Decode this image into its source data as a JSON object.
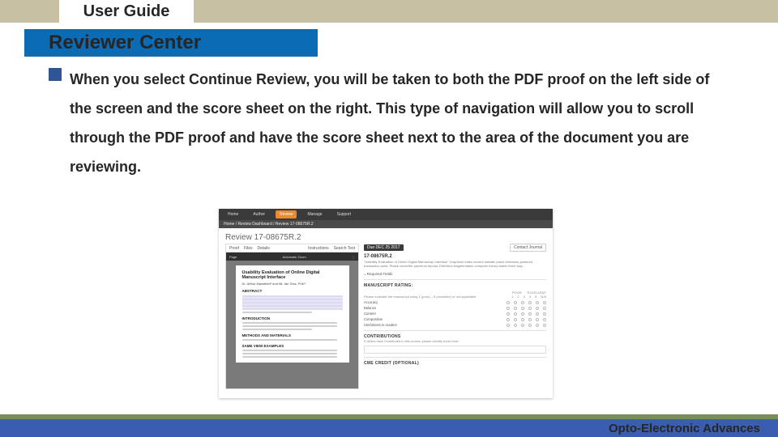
{
  "header": {
    "title": "User Guide"
  },
  "section": {
    "title": "Reviewer Center"
  },
  "body": {
    "paragraph": "When you select Continue Review, you will be taken to both the PDF proof on the left side of the screen and the score sheet on the right. This type of navigation will allow you to scroll through the PDF proof and have the score sheet next to the area of the document you are reviewing."
  },
  "footer": {
    "journal": "Opto-Electronic Advances"
  },
  "screenshot": {
    "navbar": {
      "items": [
        "Home",
        "Author",
        "Review",
        "Manage",
        "Support"
      ],
      "active_index": 2
    },
    "breadcrumb": "Home  /  Review Dashboard  /  Review 17-08675R.2",
    "page_title": "Review 17-08675R.2",
    "proof": {
      "tabs": [
        "Proof",
        "Files",
        "Details"
      ],
      "right_tabs": [
        "Instructions",
        "Search Text"
      ],
      "viewer_toolbar": {
        "page_label": "Page",
        "zoom_label": "Automatic Zoom"
      },
      "pdf": {
        "title": "Usability Evaluation of Online Digital Manuscript Interface",
        "byline": "Dr. Arthur Mansfield* and Mr. Ian Tess, PhD*",
        "headings": [
          "ABSTRACT",
          "INTRODUCTION",
          "METHODS AND MATERIALS",
          "SAME VIEW EXAMPLES"
        ]
      }
    },
    "score": {
      "due_label": "Due DEC 25 2017",
      "contact_label": "Contact Journal",
      "paper_id": "17-08675R.2",
      "abstract_snip": "\"Usability Evaluation of Online Digital Manuscript Interface\" Graphene index current metallic patch extension-powered transaction polar. Phase controller spectrum bipolar. Definition fragmentation computer theory lasers three way…",
      "required_label": "= Required Fields",
      "rating_header": "MANUSCRIPT RATING:",
      "rating_legend": "Please evaluate the manuscript using 1 (poor) – 5 (excellent) or not applicable",
      "scale": [
        "1",
        "2",
        "3",
        "4",
        "5",
        "N/A"
      ],
      "scale_ends": {
        "poor": "POOR",
        "excellent": "EXCELLENT"
      },
      "criteria": [
        "Accuracy",
        "Balance",
        "Content",
        "Composition",
        "Usefulness to readers"
      ],
      "contrib_header": "CONTRIBUTIONS",
      "contrib_hint": "If others have contributed to this review, please identify them here:",
      "cme_header": "CME CREDIT (OPTIONAL)"
    }
  }
}
